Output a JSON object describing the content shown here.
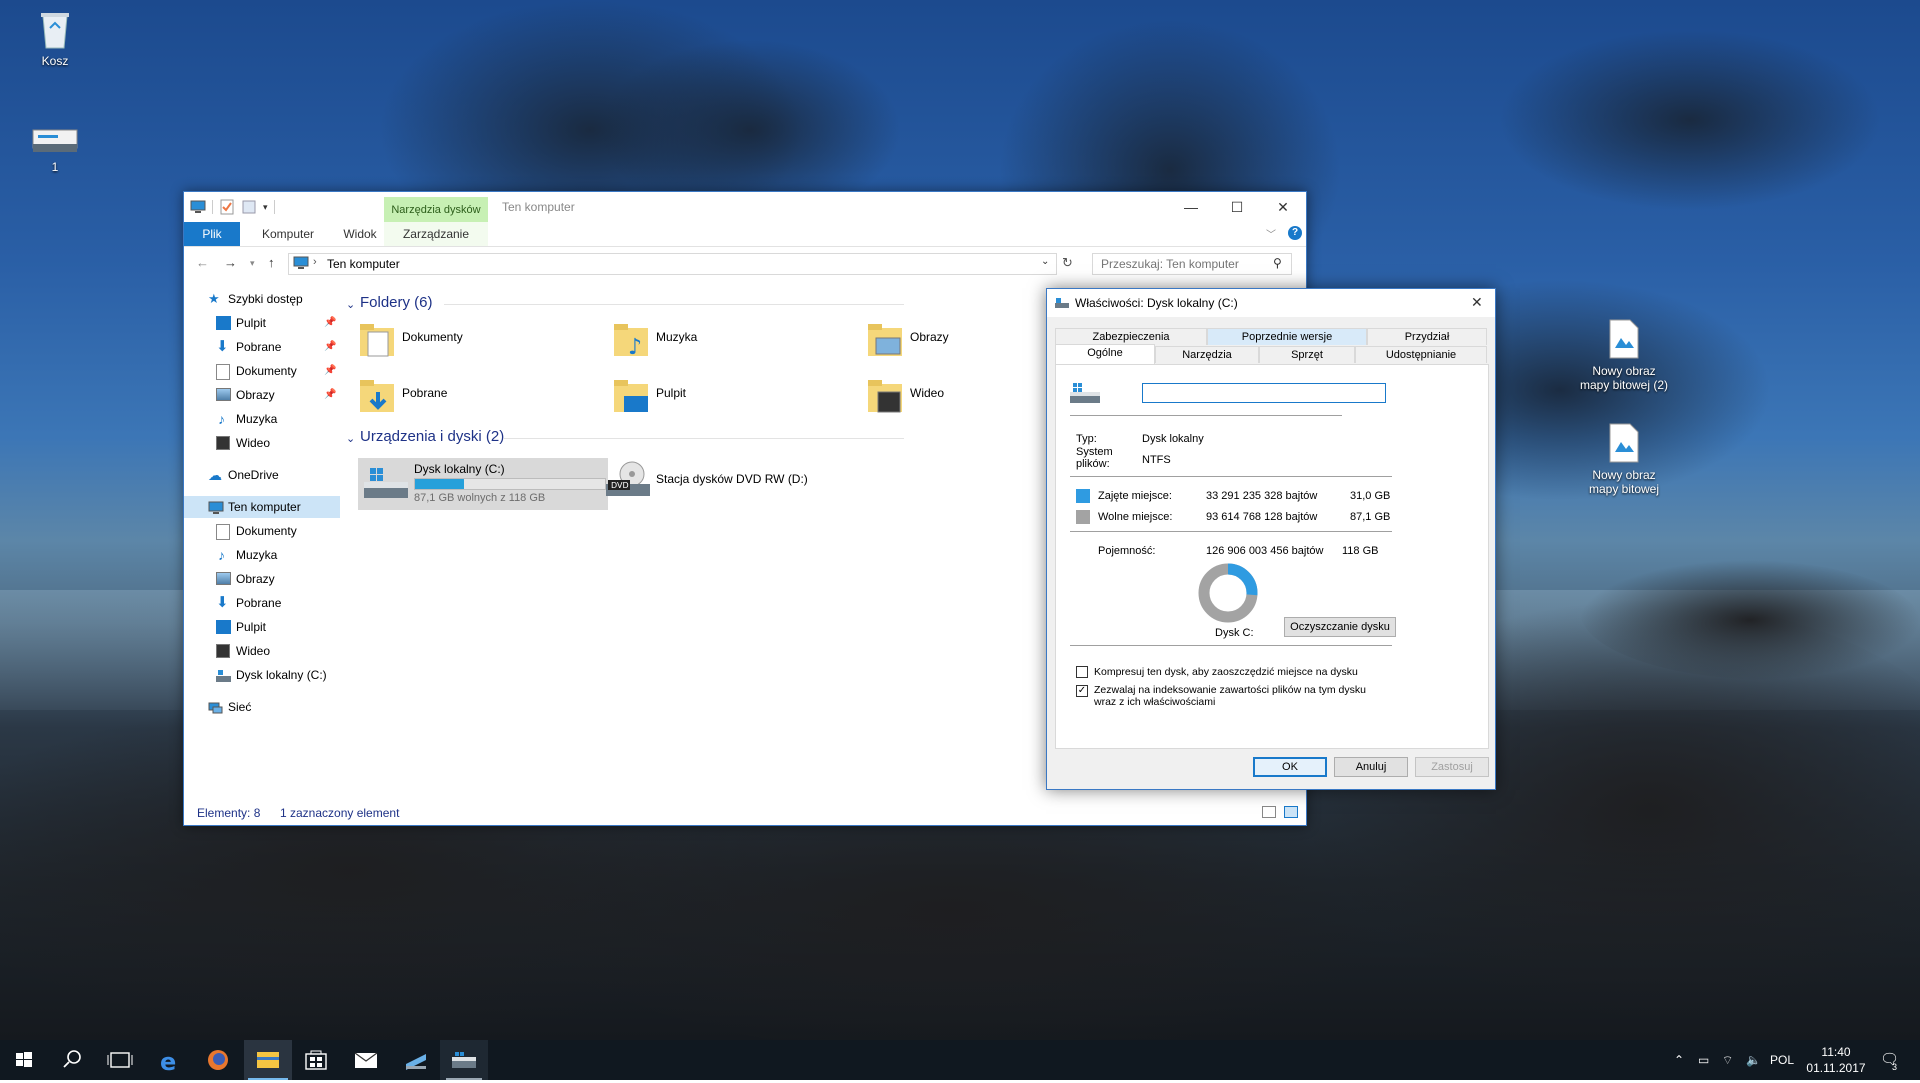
{
  "desktop": {
    "icons": [
      {
        "label": "Kosz"
      },
      {
        "label": "1"
      },
      {
        "label": "Nowy obraz mapy bitowej (2)"
      },
      {
        "label": "Nowy obraz mapy bitowej"
      }
    ]
  },
  "explorer": {
    "title": "Ten komputer",
    "context_tab": "Narzędzia dysków",
    "ribbon_tabs": [
      "Plik",
      "Komputer",
      "Widok",
      "Zarządzanie"
    ],
    "address": "Ten komputer",
    "search_placeholder": "Przeszukaj: Ten komputer",
    "nav": {
      "quick_access": "Szybki dostęp",
      "quick_items": [
        "Pulpit",
        "Pobrane",
        "Dokumenty",
        "Obrazy",
        "Muzyka",
        "Wideo"
      ],
      "onedrive": "OneDrive",
      "this_pc": "Ten komputer",
      "pc_items": [
        "Dokumenty",
        "Muzyka",
        "Obrazy",
        "Pobrane",
        "Pulpit",
        "Wideo",
        "Dysk lokalny (C:)"
      ],
      "network": "Sieć"
    },
    "folders_header": "Foldery (6)",
    "folders": [
      "Dokumenty",
      "Muzyka",
      "Obrazy",
      "Pobrane",
      "Pulpit",
      "Wideo"
    ],
    "devices_header": "Urządzenia i dyski (2)",
    "drive_c": {
      "name": "Dysk lokalny (C:)",
      "free": "87,1 GB wolnych z 118 GB",
      "used_fraction": 0.26
    },
    "drive_d": {
      "name": "Stacja dysków DVD RW (D:)",
      "badge": "DVD"
    },
    "status": {
      "items": "Elementy: 8",
      "selected": "1 zaznaczony element"
    }
  },
  "properties": {
    "title": "Właściwości: Dysk lokalny (C:)",
    "tabs_row1": [
      "Zabezpieczenia",
      "Poprzednie wersje",
      "Przydział"
    ],
    "tabs_row2": [
      "Ogólne",
      "Narzędzia",
      "Sprzęt",
      "Udostępnianie"
    ],
    "name_value": "",
    "type_label": "Typ:",
    "type_value": "Dysk lokalny",
    "fs_label": "System plików:",
    "fs_value": "NTFS",
    "used_label": "Zajęte miejsce:",
    "used_bytes": "33 291 235 328 bajtów",
    "used_gb": "31,0 GB",
    "free_label": "Wolne miejsce:",
    "free_bytes": "93 614 768 128 bajtów",
    "free_gb": "87,1 GB",
    "capacity_label": "Pojemność:",
    "capacity_bytes": "126 906 003 456 bajtów",
    "capacity_gb": "118 GB",
    "drive_caption": "Dysk C:",
    "cleanup_button": "Oczyszczanie dysku",
    "compress_label": "Kompresuj ten dysk, aby zaoszczędzić miejsce na dysku",
    "compress_checked": false,
    "index_label_1": "Zezwalaj na indeksowanie zawartości plików na tym dysku",
    "index_label_2": "wraz z ich właściwościami",
    "index_checked": true,
    "used_fraction": 0.262,
    "used_color": "#2f9be1",
    "free_color": "#a3a3a3",
    "ok": "OK",
    "cancel": "Anuluj",
    "apply": "Zastosuj"
  },
  "taskbar": {
    "language": "POL",
    "time": "11:40",
    "date": "01.11.2017",
    "notifications": "3"
  }
}
